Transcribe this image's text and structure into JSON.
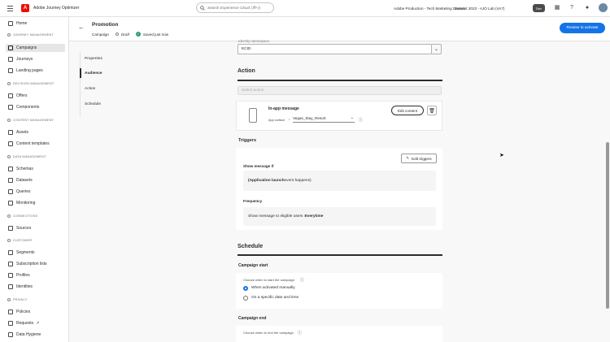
{
  "topbar": {
    "app_name": "Adobe Journey Optimizer",
    "logo_letter": "A",
    "search_placeholder": "Search Experience Cloud (⌘+/)",
    "org": "Adobe Production - Tech Marketing Demos",
    "sandbox": "Summit 2023 - AJO Lab (VA7)",
    "badge": "Dev"
  },
  "sidebar": {
    "items_top": [
      {
        "label": "Home"
      }
    ],
    "sections": [
      {
        "title": "JOURNEY MANAGEMENT",
        "items": [
          "Campaigns",
          "Journeys",
          "Landing pages"
        ]
      },
      {
        "title": "DECISION MANAGEMENT",
        "items": [
          "Offers",
          "Components"
        ]
      },
      {
        "title": "CONTENT MANAGEMENT",
        "items": [
          "Assets",
          "Content templates"
        ]
      },
      {
        "title": "DATA MANAGEMENT",
        "items": [
          "Schemas",
          "Datasets",
          "Queries",
          "Monitoring"
        ]
      },
      {
        "title": "CONNECTIONS",
        "items": [
          "Sources"
        ]
      },
      {
        "title": "CUSTOMER",
        "items": [
          "Segments",
          "Subscription lists",
          "Profiles",
          "Identities"
        ]
      },
      {
        "title": "PRIVACY",
        "items": [
          "Policies",
          "Requests",
          "Data Hygiene"
        ]
      }
    ],
    "active": "Campaigns"
  },
  "header": {
    "title": "Promotion",
    "type": "Campaign",
    "status": "Draft",
    "saved": "Saved just now",
    "review_button": "Review to activate"
  },
  "leftnav": {
    "items": [
      "Properties",
      "Audience",
      "Action",
      "Schedule"
    ],
    "active": "Audience"
  },
  "main": {
    "identity_namespace_label": "Identity namespace",
    "identity_value": "ECID",
    "action_title": "Action",
    "select_action_placeholder": "Select action",
    "inapp_title": "In-app message",
    "app_surface_label": "App surface",
    "app_surface_value": "Vegas_Stay_Resort",
    "edit_content": "Edit content",
    "triggers_title": "Triggers",
    "edit_triggers": "Edit triggers",
    "show_message_if": "Show message if",
    "trigger_condition_bold": "(Application launch",
    "trigger_condition_rest": " event happens)",
    "frequency": "Frequency",
    "frequency_text_pre": "Show message to eligible users ",
    "frequency_text_bold": "Everytime",
    "schedule_title": "Schedule",
    "campaign_start": "Campaign start",
    "choose_start": "Choose when to start the campaign",
    "radio_manual": "When activated manually",
    "radio_specific": "On a specific date and time",
    "campaign_end": "Campaign end",
    "choose_end": "Choose when to end the campaign"
  },
  "colors": {
    "accent": "#1473e6",
    "brand": "#eb1000",
    "saved": "#2d9d78"
  }
}
